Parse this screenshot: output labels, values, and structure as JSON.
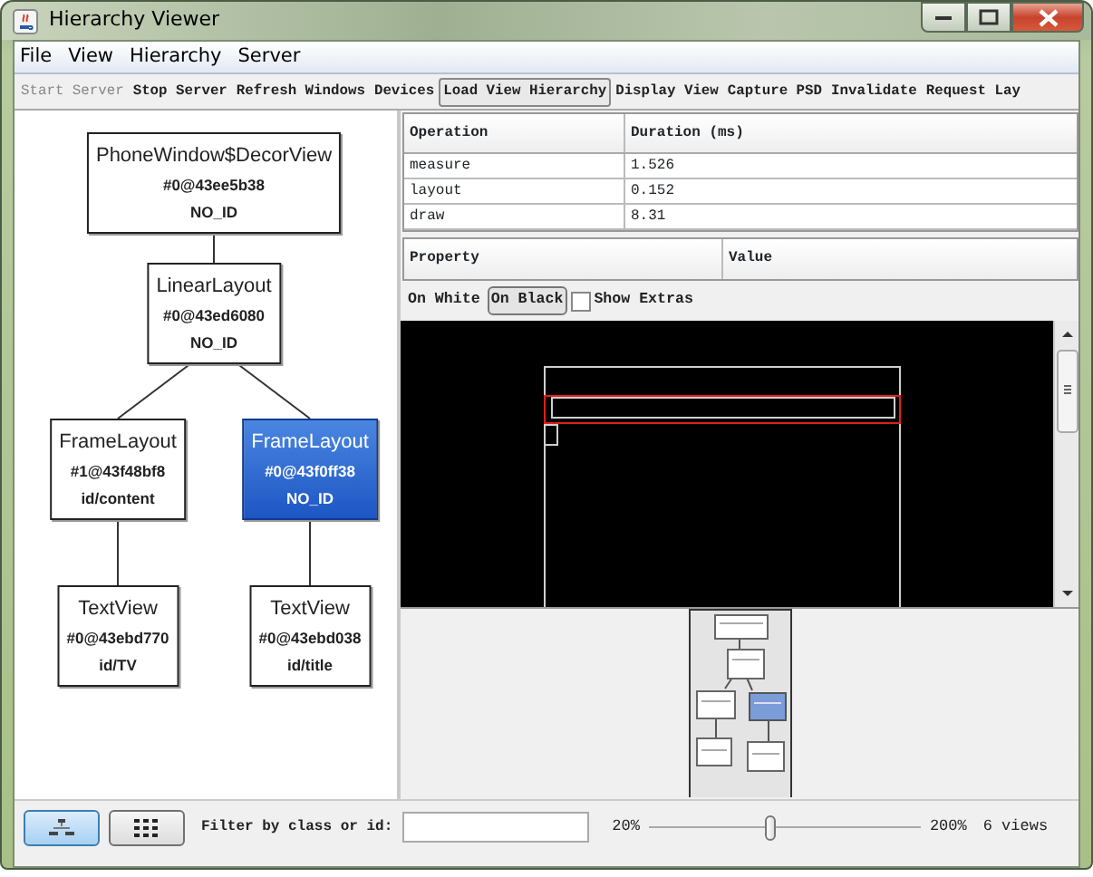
{
  "window": {
    "title": "Hierarchy Viewer"
  },
  "menu": [
    "File",
    "View",
    "Hierarchy",
    "Server"
  ],
  "toolbar": [
    {
      "label": "Start Server",
      "disabled": true,
      "focused": false
    },
    {
      "label": "Stop Server",
      "disabled": false,
      "focused": false
    },
    {
      "label": "Refresh Windows",
      "disabled": false,
      "focused": false
    },
    {
      "label": "Devices",
      "disabled": false,
      "focused": false
    },
    {
      "label": "Load View Hierarchy",
      "disabled": false,
      "focused": true
    },
    {
      "label": "Display View",
      "disabled": false,
      "focused": false
    },
    {
      "label": "Capture PSD",
      "disabled": false,
      "focused": false
    },
    {
      "label": "Invalidate",
      "disabled": false,
      "focused": false
    },
    {
      "label": "Request Lay",
      "disabled": false,
      "focused": false
    }
  ],
  "tree": {
    "name": "PhoneWindow$DecorView",
    "address": "#0@43ee5b38",
    "id": "NO_ID",
    "selected": false,
    "children": [
      {
        "name": "LinearLayout",
        "address": "#0@43ed6080",
        "id": "NO_ID",
        "selected": false,
        "children": [
          {
            "name": "FrameLayout",
            "address": "#1@43f48bf8",
            "id": "id/content",
            "selected": false,
            "children": [
              {
                "name": "TextView",
                "address": "#0@43ebd770",
                "id": "id/TV",
                "selected": false
              }
            ]
          },
          {
            "name": "FrameLayout",
            "address": "#0@43f0ff38",
            "id": "NO_ID",
            "selected": true,
            "children": [
              {
                "name": "TextView",
                "address": "#0@43ebd038",
                "id": "id/title",
                "selected": false
              }
            ]
          }
        ]
      }
    ]
  },
  "profile": {
    "columns": [
      "Operation",
      "Duration (ms)"
    ],
    "rows": [
      [
        "measure",
        "1.526"
      ],
      [
        "layout",
        "0.152"
      ],
      [
        "draw",
        "8.31"
      ]
    ]
  },
  "properties": {
    "columns": [
      "Property",
      "Value"
    ]
  },
  "preview": {
    "backgrounds": [
      {
        "label": "On White",
        "selected": false
      },
      {
        "label": "On Black",
        "selected": true
      }
    ],
    "show_extras": {
      "label": "Show Extras",
      "checked": false
    }
  },
  "bottom": {
    "view_modes": [
      {
        "kind": "tree",
        "selected": true
      },
      {
        "kind": "grid",
        "selected": false
      }
    ],
    "filter": {
      "label": "Filter by class or id:"
    },
    "zoom": {
      "min_label": "20%",
      "max_label": "200%",
      "level": 0.45
    },
    "view_count": "6 views"
  }
}
